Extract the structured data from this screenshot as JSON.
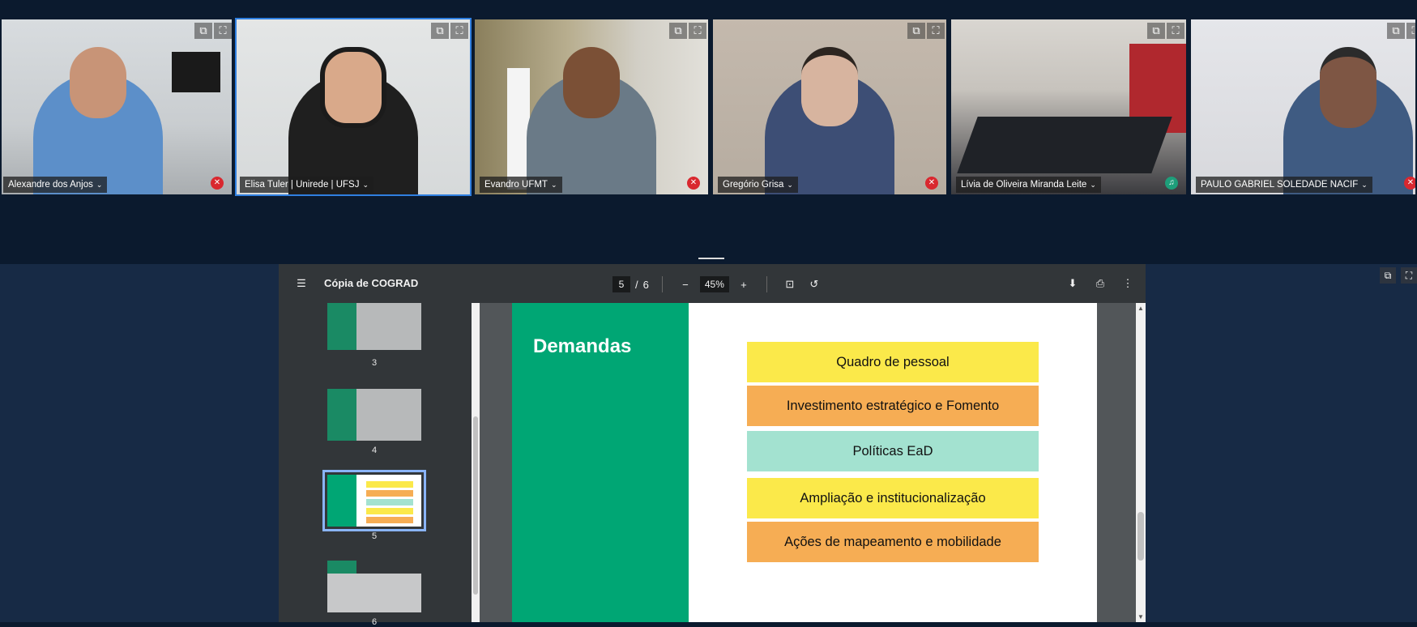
{
  "participants": [
    {
      "name": "Alexandre dos Anjos",
      "status": "muted"
    },
    {
      "name": "Elisa Tuler | Unirede | UFSJ",
      "status": "speaking"
    },
    {
      "name": "Evandro UFMT",
      "status": "muted"
    },
    {
      "name": "Gregório Grisa",
      "status": "muted"
    },
    {
      "name": "Lívia de Oliveira Miranda Leite",
      "status": "headphones"
    },
    {
      "name": "PAULO GABRIEL SOLEDADE NACIF",
      "status": "muted"
    }
  ],
  "tile_controls": {
    "popout_icon": "⧉",
    "fullscreen_icon": "⛶",
    "chevron": "⌄"
  },
  "pdf": {
    "title": "Cópia de COGRAD",
    "current_page": "5",
    "page_sep": "/",
    "total_pages": "6",
    "zoom": "45%",
    "zoom_out": "−",
    "zoom_in": "+",
    "icons": {
      "menu": "☰",
      "fit": "⊡",
      "rotate": "↺",
      "download": "⬇",
      "print": "⎙",
      "more": "⋮"
    }
  },
  "thumbnails": [
    {
      "num": "3"
    },
    {
      "num": "4"
    },
    {
      "num": "5",
      "selected": true
    },
    {
      "num": "6"
    }
  ],
  "slide": {
    "title": "Demandas",
    "items": [
      {
        "label": "Quadro de pessoal",
        "color": "#fbe94a"
      },
      {
        "label": "Investimento estratégico e Fomento",
        "color": "#f6ad54"
      },
      {
        "label": "Políticas EaD",
        "color": "#a3e2d0"
      },
      {
        "label": "Ampliação e institucionalização",
        "color": "#fbe94a"
      },
      {
        "label": "Ações de mapeamento e mobilidade",
        "color": "#f6ad54"
      }
    ]
  }
}
